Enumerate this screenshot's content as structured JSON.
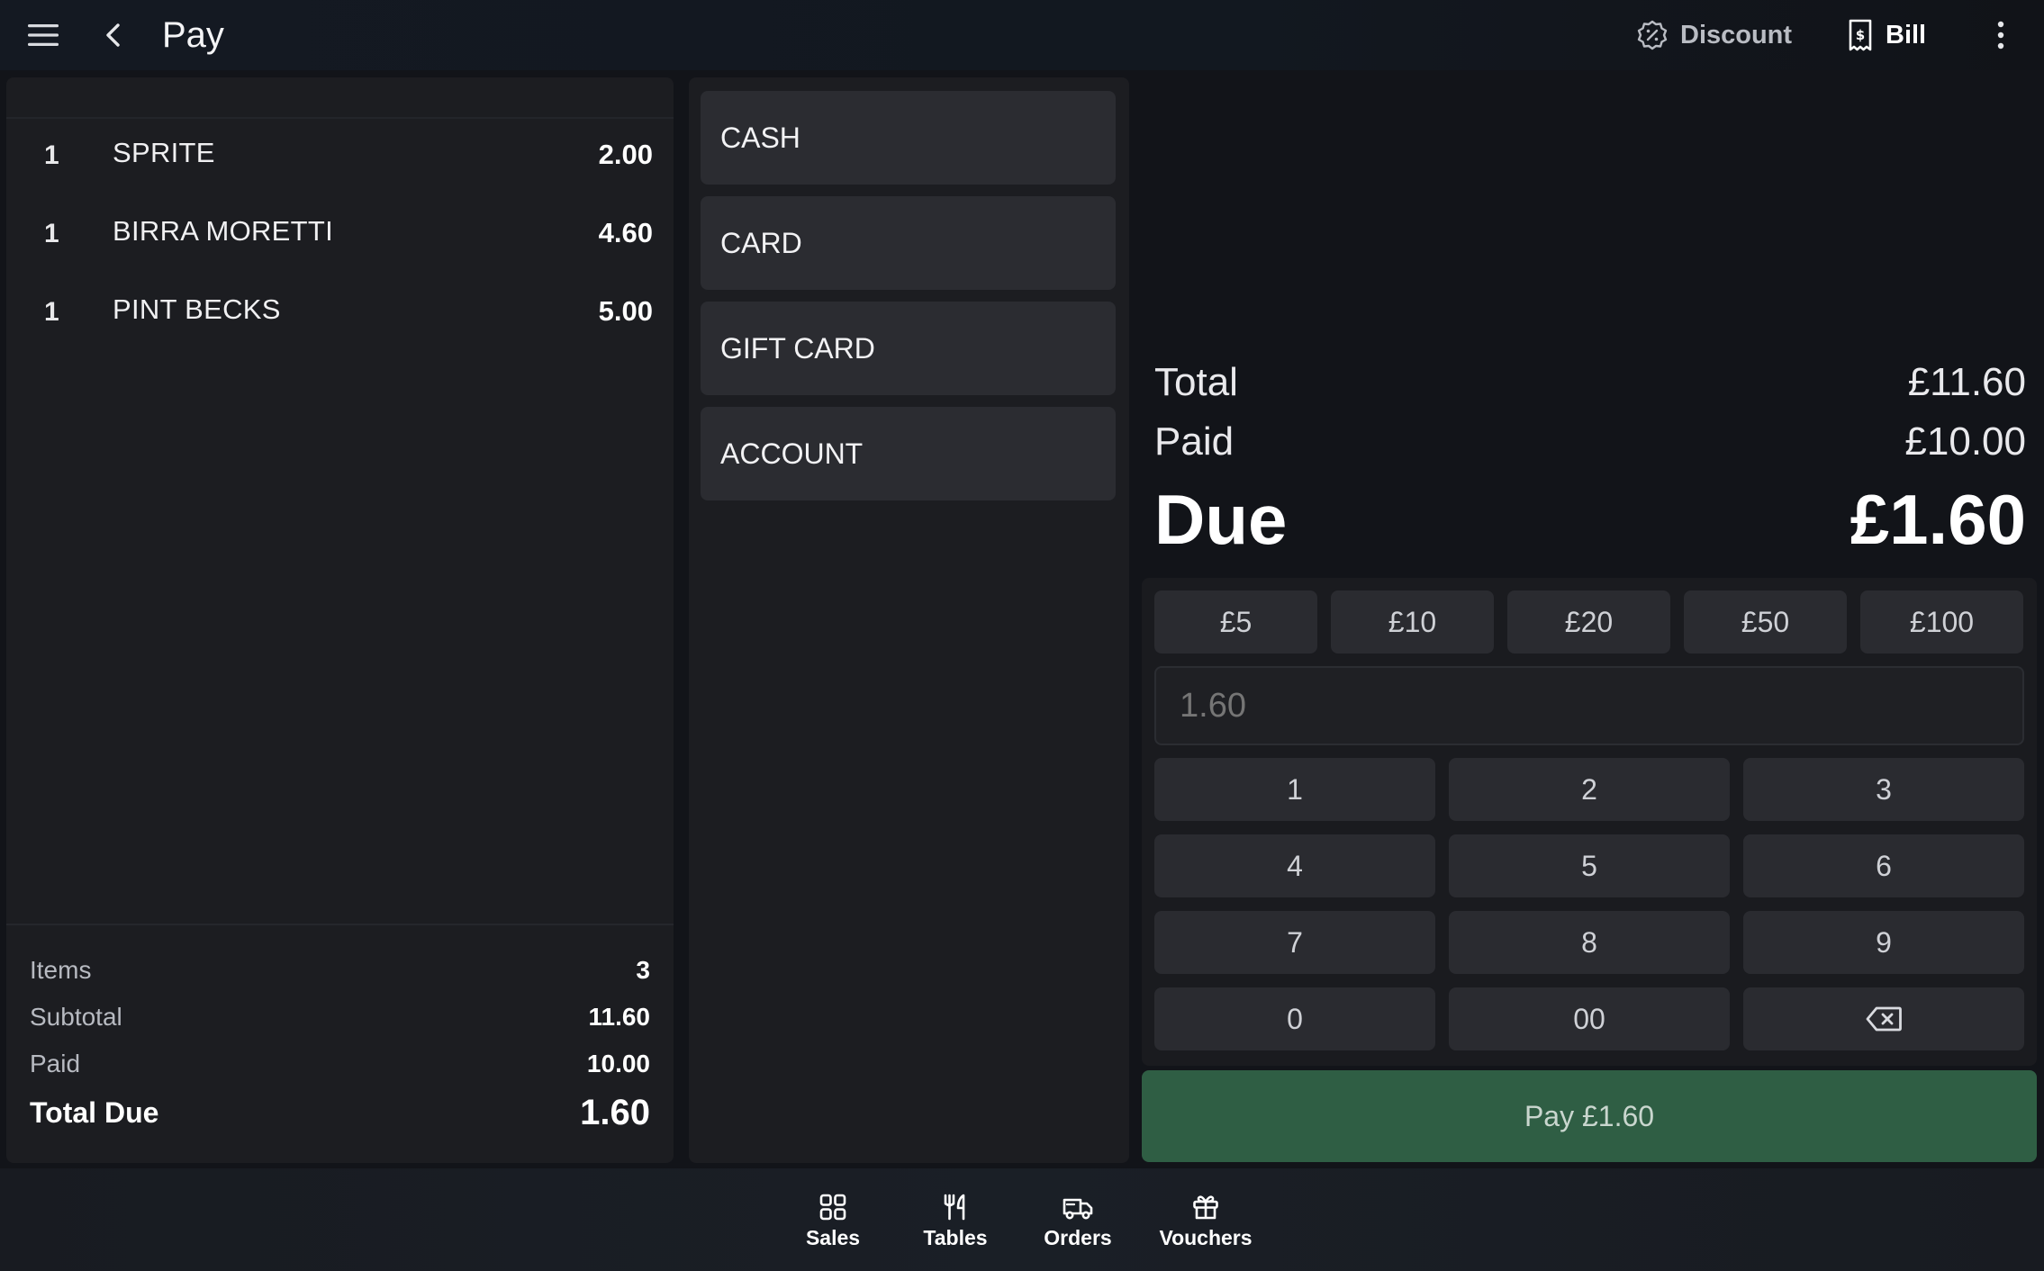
{
  "header": {
    "title": "Pay",
    "discount_label": "Discount",
    "bill_label": "Bill"
  },
  "order": {
    "items": [
      {
        "qty": "1",
        "name": "SPRITE",
        "price": "2.00"
      },
      {
        "qty": "1",
        "name": "BIRRA MORETTI",
        "price": "4.60"
      },
      {
        "qty": "1",
        "name": "PINT BECKS",
        "price": "5.00"
      }
    ],
    "summary": {
      "items_label": "Items",
      "items_value": "3",
      "subtotal_label": "Subtotal",
      "subtotal_value": "11.60",
      "paid_label": "Paid",
      "paid_value": "10.00",
      "total_due_label": "Total Due",
      "total_due_value": "1.60"
    }
  },
  "payment_methods": [
    "CASH",
    "CARD",
    "GIFT CARD",
    "ACCOUNT"
  ],
  "totals": {
    "total_label": "Total",
    "total_value": "£11.60",
    "paid_label": "Paid",
    "paid_value": "£10.00",
    "due_label": "Due",
    "due_value": "£1.60"
  },
  "keypad": {
    "quick_amounts": [
      "£5",
      "£10",
      "£20",
      "£50",
      "£100"
    ],
    "amount_placeholder": "1.60",
    "keys": [
      "1",
      "2",
      "3",
      "4",
      "5",
      "6",
      "7",
      "8",
      "9",
      "0",
      "00"
    ]
  },
  "pay_button_label": "Pay £1.60",
  "nav": {
    "sales": "Sales",
    "tables": "Tables",
    "orders": "Orders",
    "vouchers": "Vouchers"
  },
  "colors": {
    "background": "#121419",
    "panel": "#1c1d21",
    "button": "#2a2b30",
    "pay_green": "#2f5e44"
  }
}
